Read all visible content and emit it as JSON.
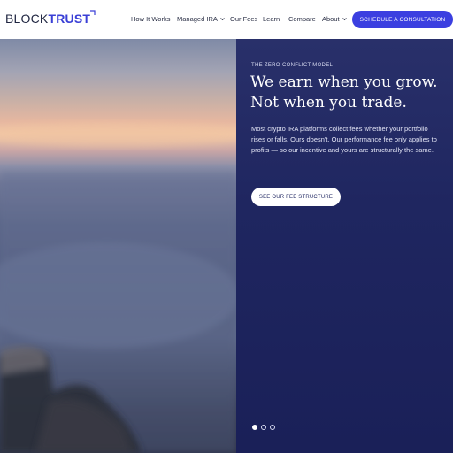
{
  "header": {
    "logo": {
      "part1": "BLOCK",
      "part2": "TRUST"
    },
    "nav": [
      {
        "label": "How It Works"
      },
      {
        "label": "Managed IRA",
        "has_dropdown": true
      },
      {
        "label": "Our Fees"
      },
      {
        "label": "Learn"
      },
      {
        "label": "Compare"
      },
      {
        "label": "About",
        "has_dropdown": true
      }
    ],
    "cta_label": "SCHEDULE A CONSULTATION"
  },
  "hero": {
    "eyebrow": "THE ZERO-CONFLICT MODEL",
    "headline_line1": "We earn when you grow.",
    "headline_line2": "Not when you trade.",
    "body": "Most crypto IRA platforms collect fees whether your portfolio rises or falls. Ours doesn't. Our performance fee only applies to profits — so our incentive and yours are structurally the same.",
    "button_label": "SEE OUR FEE STRUCTURE",
    "slides": {
      "count": 3,
      "active_index": 0
    }
  },
  "colors": {
    "brand_blue": "#3b3fe0",
    "panel_navy": "#1f2660",
    "logo_dark": "#1f2540"
  },
  "icons": {
    "logo_mark": "corner-bracket-icon",
    "dropdown": "chevron-down-icon"
  }
}
